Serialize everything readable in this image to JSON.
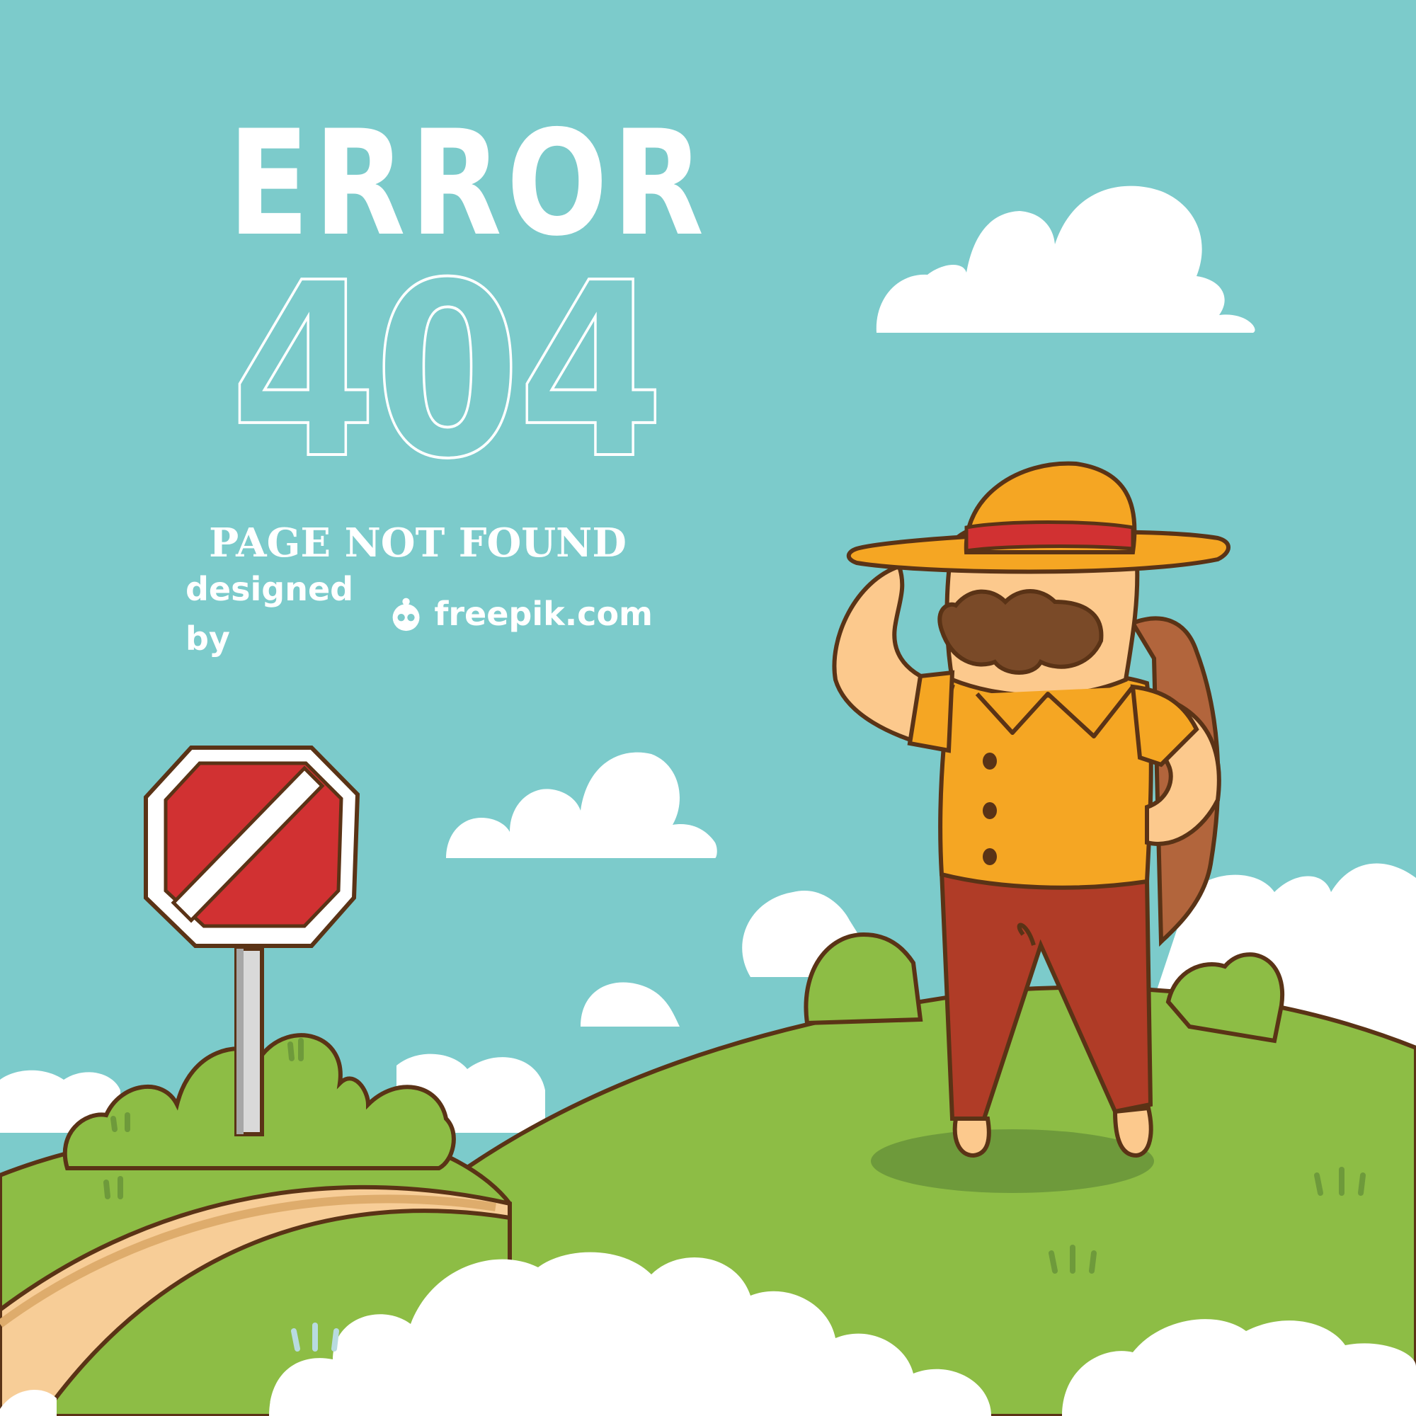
{
  "title": "ERROR",
  "code": "404",
  "message": "PAGE NOT FOUND",
  "credit": {
    "prefix": "designed by",
    "site": "freepik.com",
    "logo_icon": "freepik-logo-icon"
  },
  "colors": {
    "sky": "#7ccbcb",
    "cloud": "#ffffff",
    "grass": "#8dbd45",
    "grass_dark": "#6e9a3b",
    "outline": "#5a3316",
    "path": "#f7cd97",
    "sign_red": "#d13132",
    "hat": "#f5a623",
    "shirt": "#f5a623",
    "pants": "#b03c27",
    "skin": "#fcc98d",
    "mustache": "#7a4a28",
    "backpack": "#b2653c"
  }
}
